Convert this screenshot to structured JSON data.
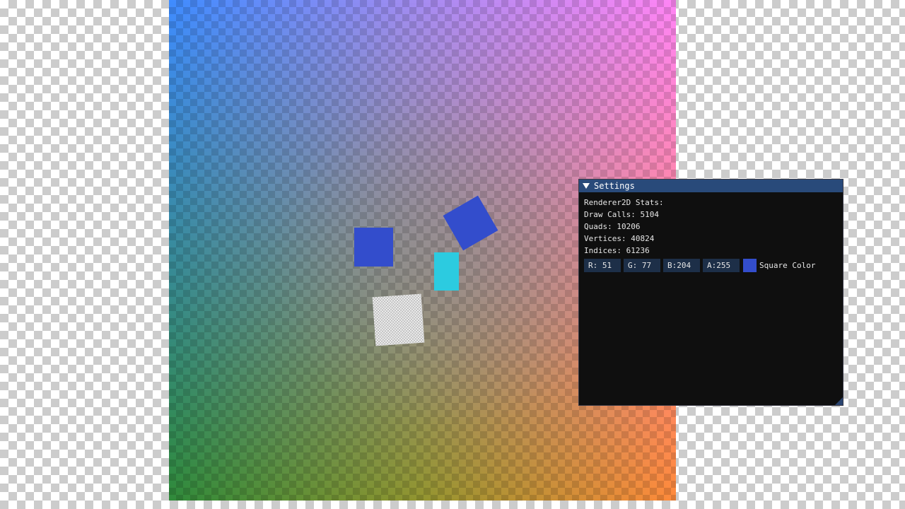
{
  "scene": {
    "square_color": "#334dcc",
    "rotated_square_color": "#334dcc",
    "cyan_square_color": "#2ccbe0"
  },
  "settings_window": {
    "title": "Settings",
    "stats_header": "Renderer2D Stats:",
    "draw_calls": "Draw Calls: 5104",
    "quads": "Quads: 10206",
    "vertices": "Vertices: 40824",
    "indices": "Indices: 61236",
    "color_edit": {
      "r_field": "R: 51",
      "g_field": "G: 77",
      "b_field": "B:204",
      "a_field": "A:255",
      "label": "Square Color",
      "swatch_color": "#334dcc"
    }
  }
}
